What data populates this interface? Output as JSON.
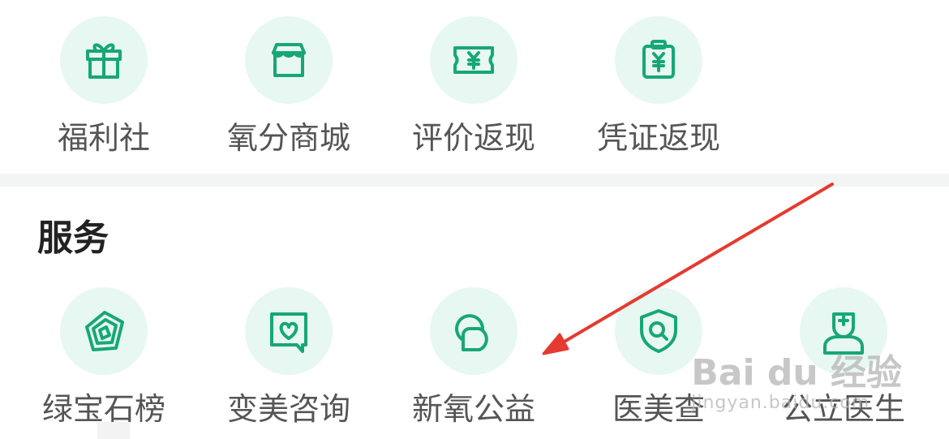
{
  "top_row": [
    {
      "label": "福利社",
      "icon": "gift-icon"
    },
    {
      "label": "氧分商城",
      "icon": "shop-icon"
    },
    {
      "label": "评价返现",
      "icon": "yen-ticket-icon"
    },
    {
      "label": "凭证返现",
      "icon": "yen-clipboard-icon"
    }
  ],
  "services": {
    "title": "服务",
    "items": [
      {
        "label": "绿宝石榜",
        "icon": "gem-icon"
      },
      {
        "label": "变美咨询",
        "icon": "chat-heart-icon"
      },
      {
        "label": "新氧公益",
        "icon": "charity-icon"
      },
      {
        "label": "医美查",
        "icon": "shield-search-icon"
      },
      {
        "label": "公立医生",
        "icon": "doctor-icon"
      }
    ]
  },
  "watermark": {
    "main": "Bai du 经验",
    "sub": "jingyan.baidu.com"
  },
  "colors": {
    "accent": "#17a776",
    "icon_bg": "#e7f7f1",
    "arrow": "#e53a2f"
  }
}
